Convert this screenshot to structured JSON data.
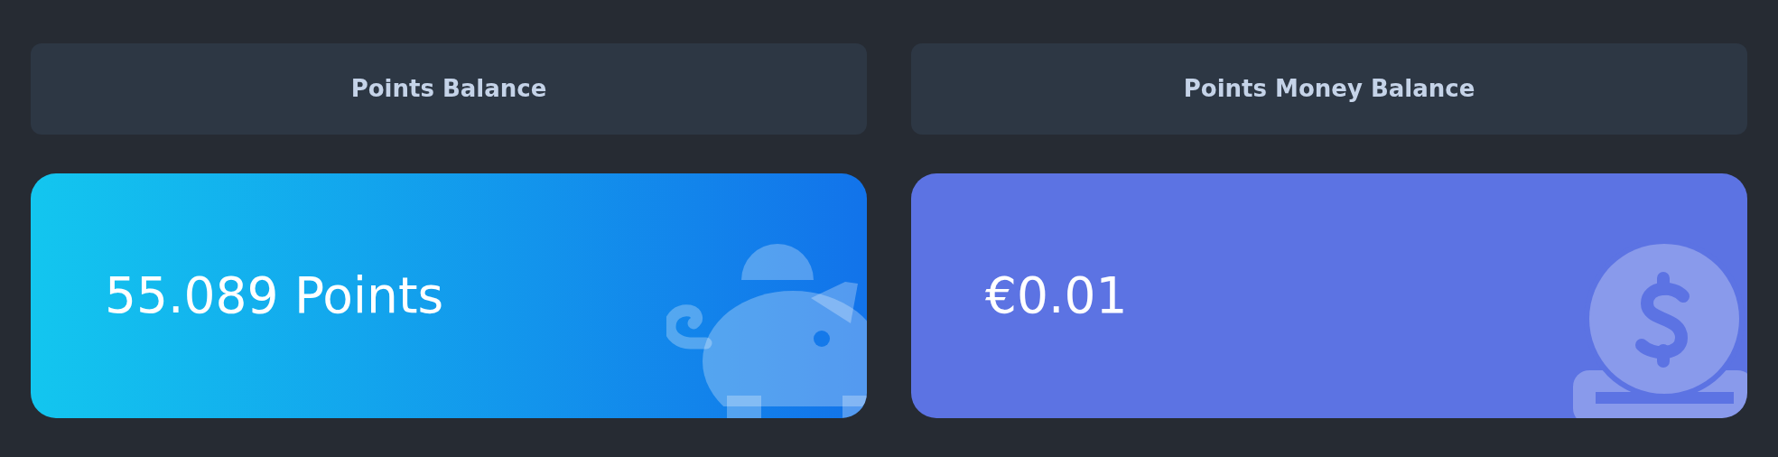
{
  "cards": [
    {
      "kind": "points",
      "title": "Points Balance",
      "value": "55.089 Points"
    },
    {
      "kind": "money",
      "title": "Points Money Balance",
      "value": "€0.01"
    }
  ]
}
